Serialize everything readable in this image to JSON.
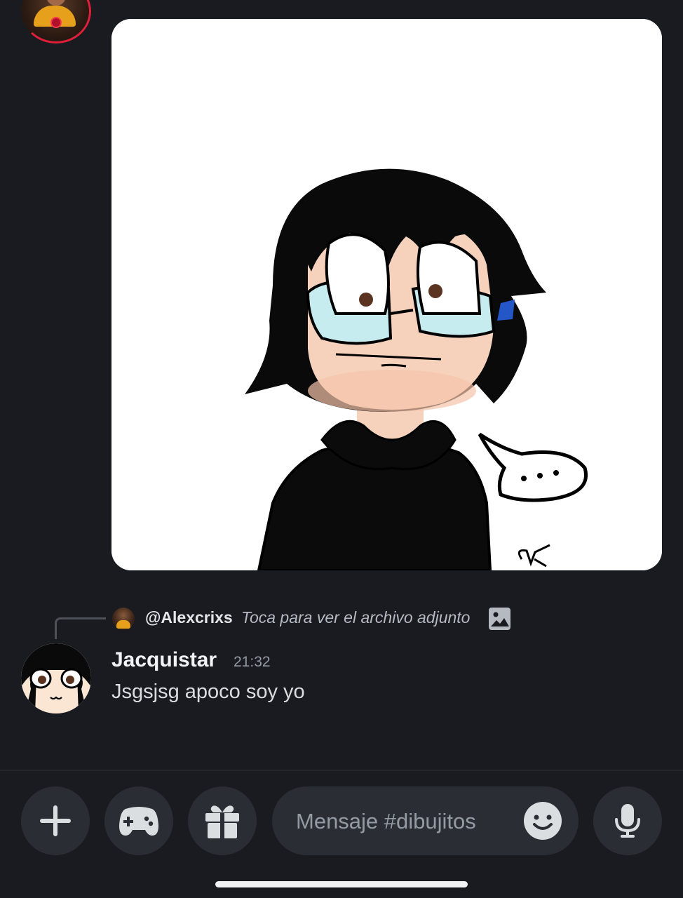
{
  "reply": {
    "username": "@Alexcrixs",
    "preview_text": "Toca para ver el archivo adjunto"
  },
  "message": {
    "author": "Jacquistar",
    "time": "21:32",
    "text": "Jsgsjsg apoco soy yo"
  },
  "composer": {
    "placeholder": "Mensaje #dibujitos"
  },
  "colors": {
    "background": "#1a1b21",
    "button_bg": "#2b2d35",
    "accent_ring": "#e0203a"
  }
}
